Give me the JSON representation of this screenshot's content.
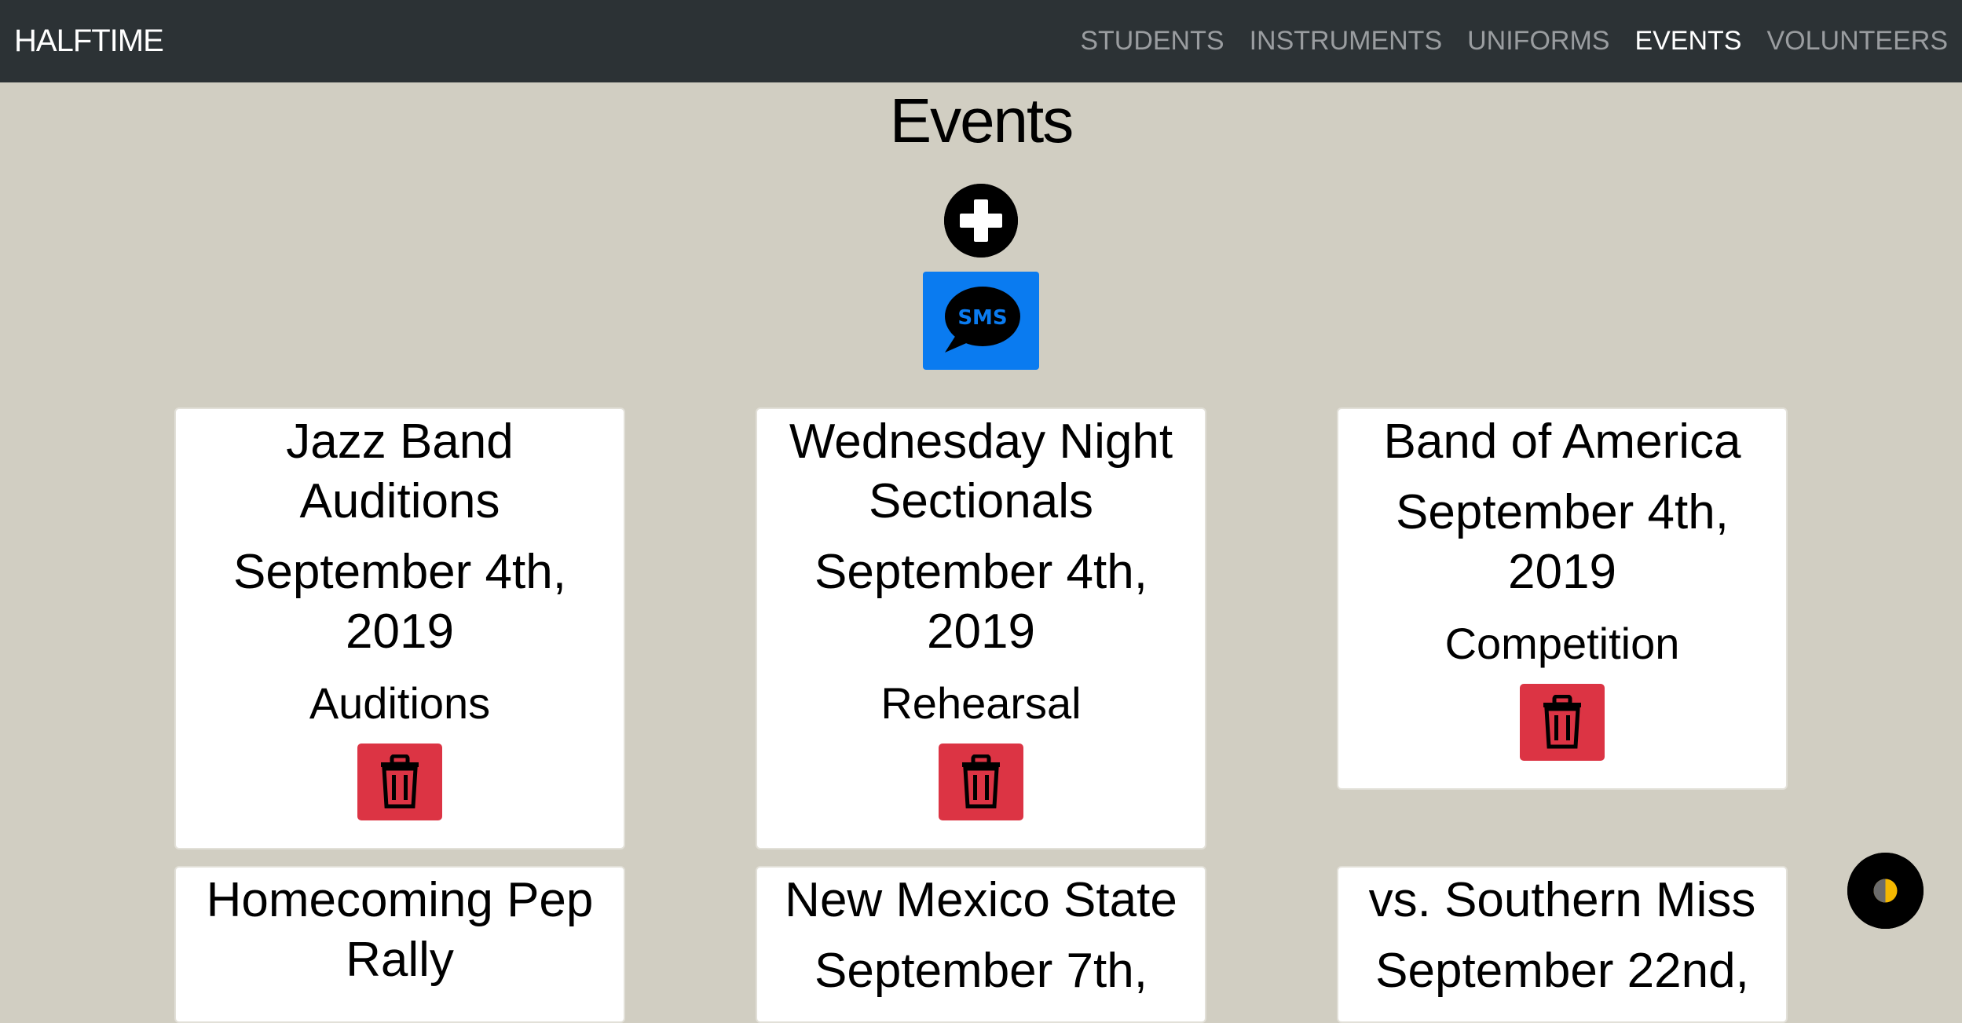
{
  "navbar": {
    "brand": "HALFTIME",
    "links": [
      {
        "label": "STUDENTS",
        "active": false
      },
      {
        "label": "INSTRUMENTS",
        "active": false
      },
      {
        "label": "UNIFORMS",
        "active": false
      },
      {
        "label": "EVENTS",
        "active": true
      },
      {
        "label": "VOLUNTEERS",
        "active": false
      }
    ]
  },
  "page": {
    "title": "Events",
    "add_icon": "plus-circle-icon",
    "sms_icon": "sms-bubble-icon",
    "sms_label": "SMS"
  },
  "events": [
    {
      "title": "Jazz Band Auditions",
      "date": "September 4th, 2019",
      "type": "Auditions"
    },
    {
      "title": "Wednesday Night Sectionals",
      "date": "September 4th, 2019",
      "type": "Rehearsal"
    },
    {
      "title": "Band of America",
      "date": "September 4th, 2019",
      "type": "Competition"
    },
    {
      "title": "Homecoming Pep Rally",
      "date": "",
      "type": ""
    },
    {
      "title": "New Mexico State",
      "date": "September 7th,",
      "type": ""
    },
    {
      "title": "vs. Southern Miss",
      "date": "September 22nd,",
      "type": ""
    }
  ],
  "colors": {
    "background": "#d1cec2",
    "navbar": "#2c3235",
    "sms_button": "#0a7bf0",
    "delete_button": "#dc3444",
    "theme_toggle_accent": "#f5b800"
  },
  "theme_toggle_icon": "half-moon-icon",
  "delete_icon": "trash-icon"
}
